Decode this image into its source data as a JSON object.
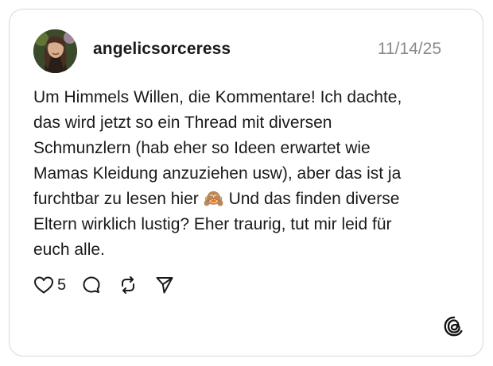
{
  "post": {
    "username": "angelicsorceress",
    "date": "11/14/25",
    "text": "Um Himmels Willen, die Kommentare! Ich dachte,\ndas wird jetzt so ein Thread mit diversen\nSchmunzlern (hab eher so Ideen erwartet wie\nMamas Kleidung anzuziehen usw), aber das ist ja\nfurchtbar zu lesen hier 🙈 Und das finden diverse\nEltern wirklich lustig? Eher traurig, tut mir leid für\neuch alle.",
    "like_count": "5"
  },
  "icons": {
    "like": "heart-icon",
    "comment": "comment-icon",
    "repost": "repost-icon",
    "share": "share-icon",
    "brand": "threads-logo-icon"
  },
  "colors": {
    "text": "#1a1a1a",
    "muted": "#8a8a8a",
    "border": "#d8d8d8"
  }
}
